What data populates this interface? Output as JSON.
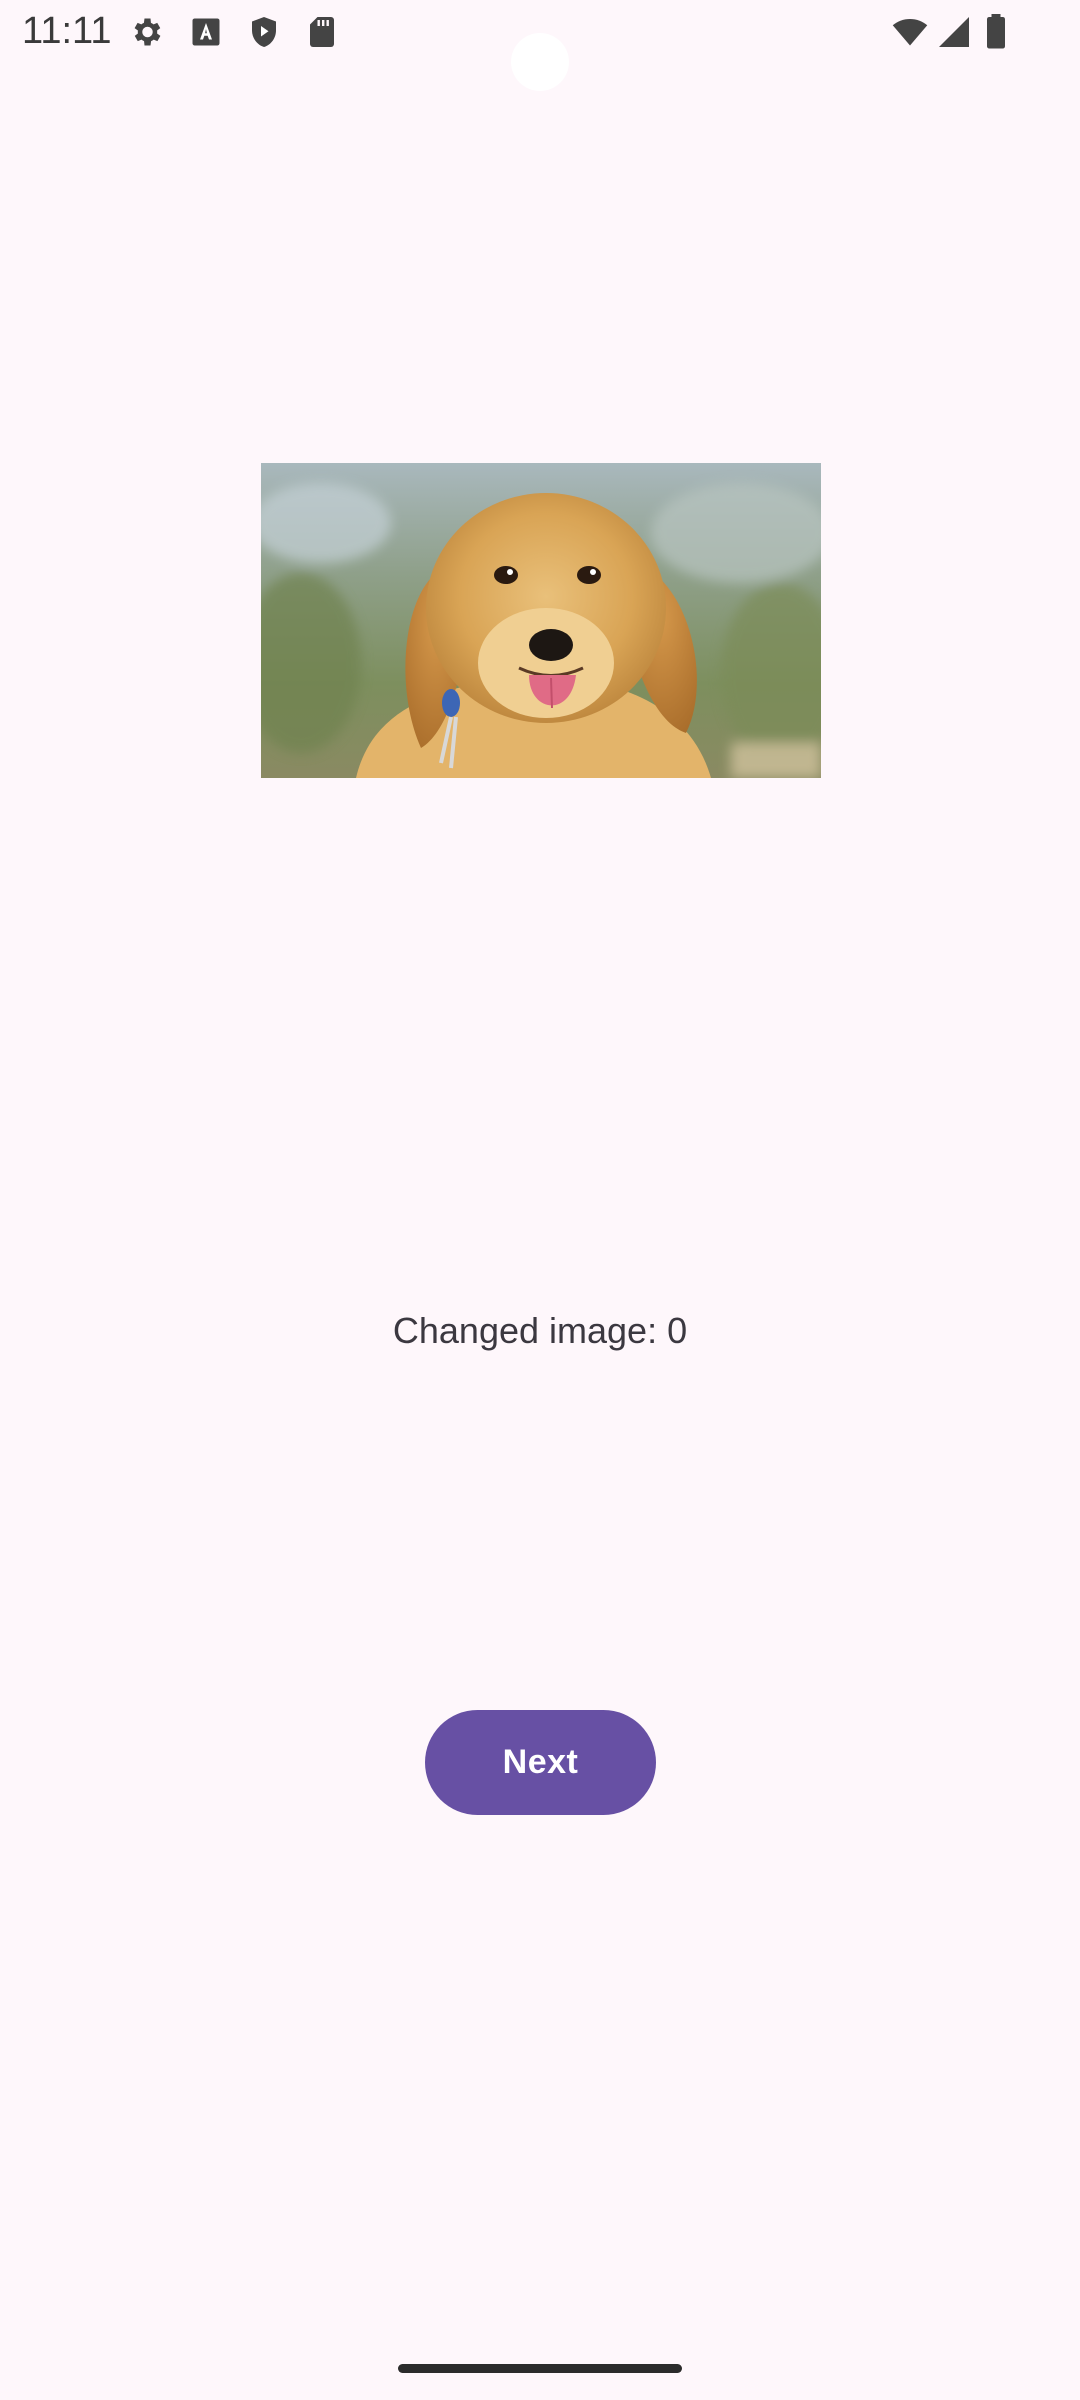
{
  "status_bar": {
    "time": "11:11",
    "left_icons": [
      "gear-icon",
      "font-a-icon",
      "shield-play-icon",
      "sd-card-icon"
    ],
    "right_icons": [
      "wifi-icon",
      "signal-icon",
      "battery-icon"
    ]
  },
  "main": {
    "image_subject": "golden retriever puppy",
    "counter_text": "Changed image: 0",
    "next_label": "Next"
  },
  "colors": {
    "background": "#fef7fb",
    "accent": "#6750a4",
    "button_text": "#ffffff"
  }
}
